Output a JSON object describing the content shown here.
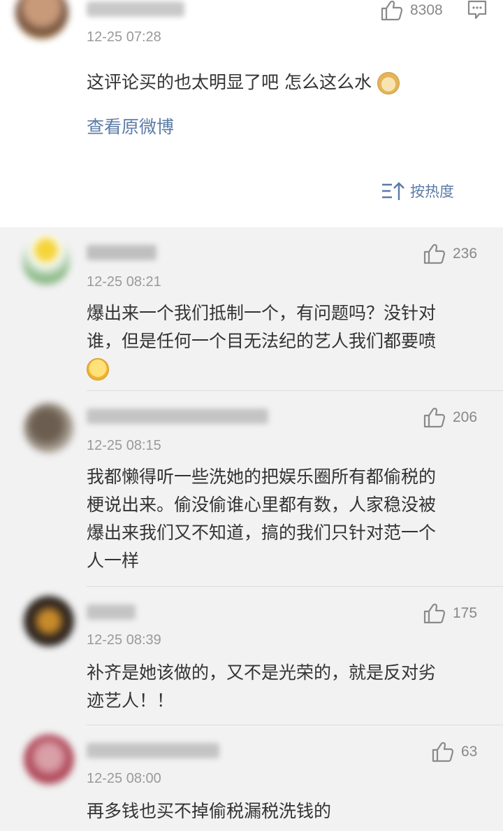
{
  "post": {
    "like_count": "8308",
    "time": "12-25 07:28",
    "text": "这评论买的也太明显了吧 怎么这么水",
    "emoji_icon": "doge-emoji-icon",
    "view_original": "查看原微博",
    "sort_label": "按热度"
  },
  "comments": [
    {
      "time": "12-25 08:21",
      "likes": "236",
      "lines": [
        "爆出来一个我们抵制一个，有问题吗？没针对",
        "谁，但是任何一个目无法纪的艺人我们都要喷"
      ],
      "emoji_icon": "smirk-emoji-icon"
    },
    {
      "time": "12-25 08:15",
      "likes": "206",
      "lines": [
        "我都懒得听一些洗她的把娱乐圈所有都偷税的",
        "梗说出来。偷没偷谁心里都有数，人家稳没被",
        "爆出来我们又不知道，搞的我们只针对范一个",
        "人一样"
      ]
    },
    {
      "time": "12-25 08:39",
      "likes": "175",
      "lines": [
        "补齐是她该做的，又不是光荣的，就是反对劣",
        "迹艺人！！"
      ]
    },
    {
      "time": "12-25 08:00",
      "likes": "63",
      "lines": [
        "再多钱也买不掉偷税漏税洗钱的"
      ]
    }
  ],
  "colors": {
    "link": "#5b7ba6",
    "time": "#9a9a9a",
    "background": "#f2f2f2"
  }
}
